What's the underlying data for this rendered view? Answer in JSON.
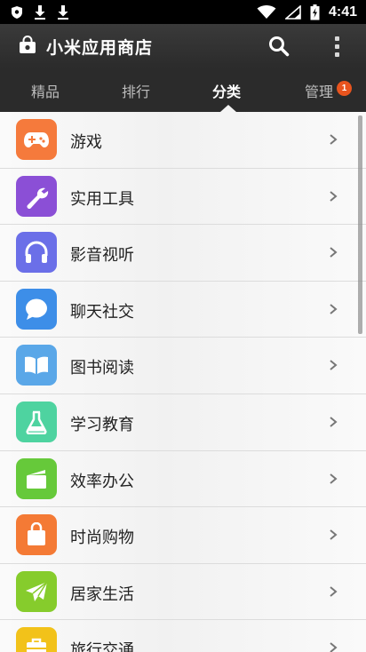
{
  "status_bar": {
    "time": "4:41"
  },
  "app": {
    "title": "小米应用商店"
  },
  "tabs": [
    {
      "label": "精品"
    },
    {
      "label": "排行"
    },
    {
      "label": "分类"
    },
    {
      "label": "管理"
    }
  ],
  "active_tab": "分类",
  "manage_badge": "1",
  "categories": [
    {
      "label": "游戏",
      "icon": "gamepad-icon",
      "color": "#f57a3c"
    },
    {
      "label": "实用工具",
      "icon": "wrench-icon",
      "color": "#8b4fd6"
    },
    {
      "label": "影音视听",
      "icon": "headphones-icon",
      "color": "#6b6fe8"
    },
    {
      "label": "聊天社交",
      "icon": "chat-bubble-icon",
      "color": "#3d8ee8"
    },
    {
      "label": "图书阅读",
      "icon": "book-icon",
      "color": "#5aa7e8"
    },
    {
      "label": "学习教育",
      "icon": "flask-icon",
      "color": "#4ed3a0"
    },
    {
      "label": "效率办公",
      "icon": "folder-icon",
      "color": "#66c93a"
    },
    {
      "label": "时尚购物",
      "icon": "shopping-bag-icon",
      "color": "#f47a35"
    },
    {
      "label": "居家生活",
      "icon": "paper-plane-icon",
      "color": "#86cc2c"
    },
    {
      "label": "旅行交通",
      "icon": "suitcase-icon",
      "color": "#f2c21a"
    }
  ]
}
